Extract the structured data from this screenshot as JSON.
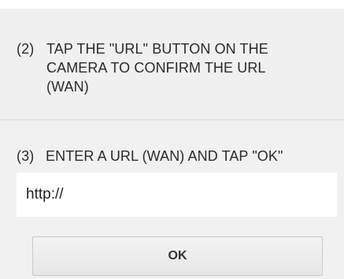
{
  "step2": {
    "number": "(2)",
    "text": "TAP THE \"URL\" BUTTON ON THE\nCAMERA TO CONFIRM THE URL\n(WAN)"
  },
  "step3": {
    "number": "(3)",
    "text": "ENTER A URL (WAN) AND TAP \"OK\""
  },
  "url_field": {
    "value": "http://"
  },
  "ok_button": {
    "label": "OK"
  }
}
